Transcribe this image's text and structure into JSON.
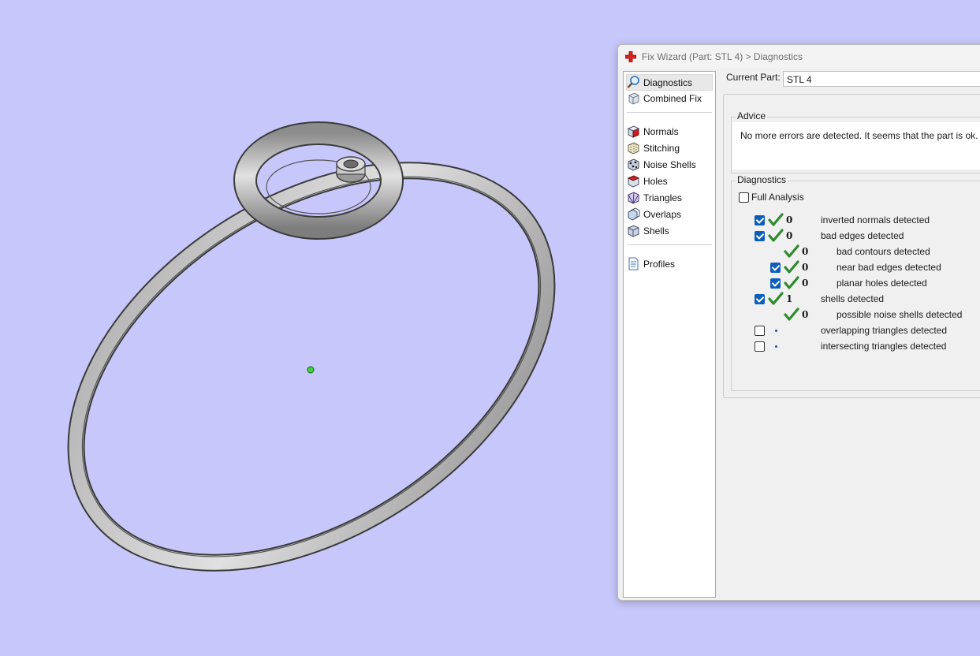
{
  "window": {
    "title": "Fix Wizard (Part: STL 4) > Diagnostics"
  },
  "nav": {
    "items": [
      {
        "label": "Diagnostics",
        "icon": "magnifier-icon"
      },
      {
        "label": "Combined Fix",
        "icon": "cube-icon"
      },
      {
        "label": "Normals",
        "icon": "cube-red-face-icon"
      },
      {
        "label": "Stitching",
        "icon": "cube-stitch-icon"
      },
      {
        "label": "Noise Shells",
        "icon": "noise-shells-icon"
      },
      {
        "label": "Holes",
        "icon": "cube-hole-icon"
      },
      {
        "label": "Triangles",
        "icon": "triangles-icon"
      },
      {
        "label": "Overlaps",
        "icon": "overlaps-icon"
      },
      {
        "label": "Shells",
        "icon": "shells-icon"
      },
      {
        "label": "Profiles",
        "icon": "document-icon"
      }
    ]
  },
  "current_part": {
    "label": "Current Part:",
    "value": "STL 4"
  },
  "advice": {
    "title": "Advice",
    "text": "No more errors are detected. It seems that the part is ok. Note"
  },
  "diagnostics": {
    "title": "Diagnostics",
    "full_analysis_label": "Full Analysis",
    "full_analysis_checked": false,
    "rows": [
      {
        "label": "inverted normals detected",
        "count": "0",
        "checked": true,
        "status": "ok"
      },
      {
        "label": "bad edges detected",
        "count": "0",
        "checked": true,
        "status": "ok"
      },
      {
        "label": "bad contours detected",
        "count": "0",
        "checked": null,
        "status": "ok"
      },
      {
        "label": "near bad edges detected",
        "count": "0",
        "checked": true,
        "status": "ok"
      },
      {
        "label": "planar holes detected",
        "count": "0",
        "checked": true,
        "status": "ok"
      },
      {
        "label": "shells detected",
        "count": "1",
        "checked": true,
        "status": "ok"
      },
      {
        "label": "possible noise shells detected",
        "count": "0",
        "checked": null,
        "status": "ok"
      },
      {
        "label": "overlapping triangles detected",
        "count": "",
        "checked": false,
        "status": "not-run"
      },
      {
        "label": "intersecting triangles detected",
        "count": "",
        "checked": false,
        "status": "not-run"
      }
    ]
  },
  "colors": {
    "viewport_bg": "#c7c7fb",
    "check_green": "#2e8b2e",
    "checkbox_blue": "#0b5fbb"
  }
}
